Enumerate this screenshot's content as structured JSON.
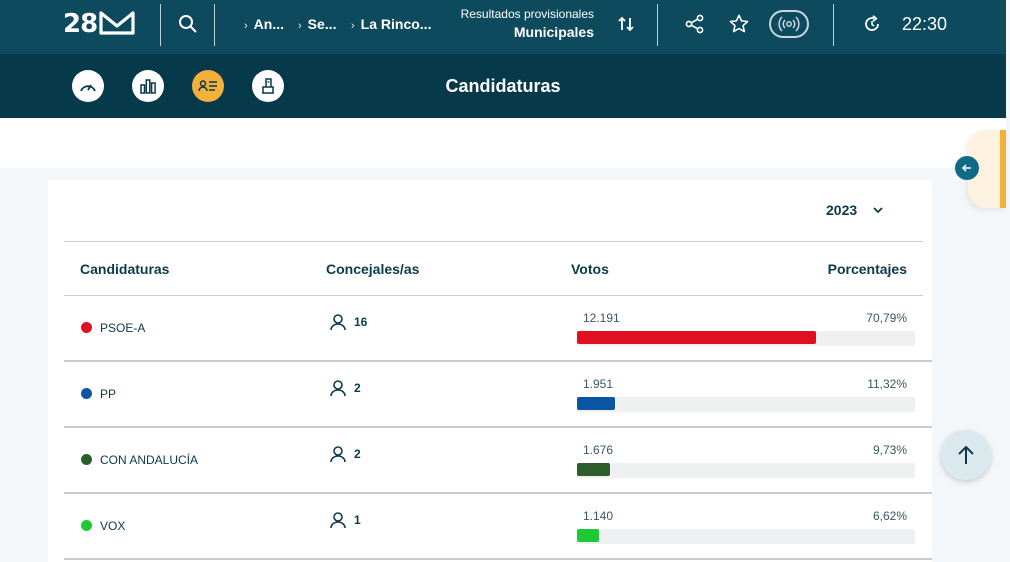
{
  "header": {
    "logo_text": "28",
    "breadcrumbs": [
      {
        "label": "An..."
      },
      {
        "label": "Se..."
      },
      {
        "label": "La Rinco..."
      }
    ],
    "results_line1": "Resultados provisionales",
    "results_line2": "Municipales",
    "time": "22:30"
  },
  "subnav": {
    "title": "Candidaturas",
    "items": [
      {
        "icon": "gauge-icon",
        "active": false
      },
      {
        "icon": "bar-chart-icon",
        "active": false
      },
      {
        "icon": "candidates-icon",
        "active": true
      },
      {
        "icon": "ballot-icon",
        "active": false
      }
    ]
  },
  "table": {
    "year": "2023",
    "headers": {
      "party": "Candidaturas",
      "seats": "Concejales/as",
      "votes": "Votos",
      "percent": "Porcentajes"
    },
    "rows": [
      {
        "party": "PSOE-A",
        "seats": "16",
        "votes": "12.191",
        "percent": "70,79%",
        "share": 0.7079,
        "color": "#e01020"
      },
      {
        "party": "PP",
        "seats": "2",
        "votes": "1.951",
        "percent": "11,32%",
        "share": 0.1132,
        "color": "#0b56a4"
      },
      {
        "party": "CON ANDALUCÍA",
        "seats": "2",
        "votes": "1.676",
        "percent": "9,73%",
        "share": 0.0973,
        "color": "#2d5e2a"
      },
      {
        "party": "VOX",
        "seats": "1",
        "votes": "1.140",
        "percent": "6,62%",
        "share": 0.0662,
        "color": "#1ec936"
      }
    ]
  },
  "colors": {
    "topbar": "#0e4a5d",
    "subbar": "#06394a",
    "accent": "#f3b13b"
  }
}
